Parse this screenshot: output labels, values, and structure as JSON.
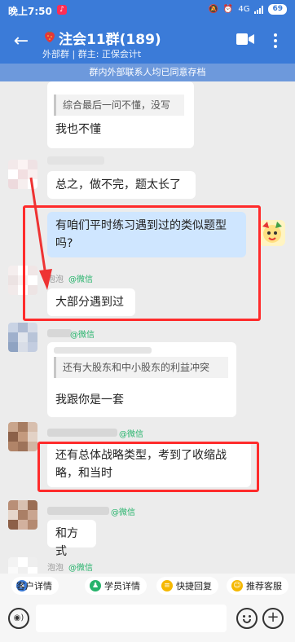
{
  "status_bar": {
    "time": "晚上7:50",
    "network": "4G",
    "battery": "69"
  },
  "header": {
    "title": "注会11群(189)",
    "subtitle": "外部群 | 群主: 正保会计t"
  },
  "notice": "群内外部联系人均已同意存档",
  "messages": {
    "m1_quote": "综合最后一问不懂，没写",
    "m1_text": "我也不懂",
    "m2_text": "总之，做不完，题太长了",
    "m3_text": "有咱们平时练习遇到过的类似题型吗?",
    "m4_nick": "泡泡",
    "m4_tag": "@微信",
    "m4_text": "大部分遇到过",
    "m5_tag": "@微信",
    "m5_quote": "还有大股东和中小股东的利益冲突",
    "m5_text": "我跟你是一套",
    "m6_tag": "@微信",
    "m6_text": "还有总体战略类型，考到了收缩战略，和当时",
    "m7_tag": "@微信",
    "m7_text": "和方式",
    "m8_nick": "泡泡",
    "m8_tag": "@微信"
  },
  "quick_actions": {
    "customer": "客户详情",
    "student": "学员详情",
    "reply": "快捷回复",
    "recommend": "推荐客服"
  },
  "input": {
    "placeholder": ""
  },
  "colors": {
    "primary": "#3b7bd8",
    "highlight": "#ff2b2b",
    "wechat_tag": "#26b36b"
  }
}
